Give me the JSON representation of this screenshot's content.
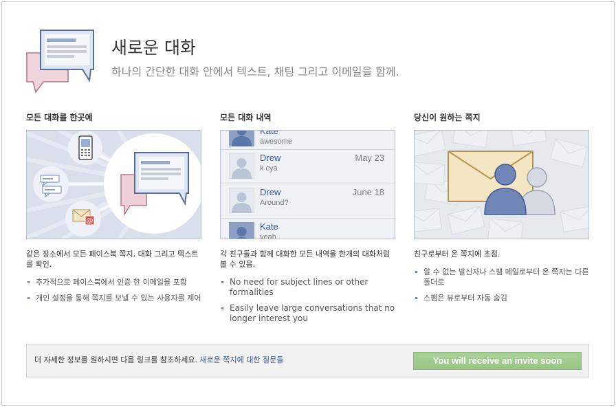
{
  "header": {
    "title": "새로운 대화",
    "subtitle": "하나의 간단한 대화 안에서 텍스트, 채팅 그리고 이메일을 함께."
  },
  "columns": [
    {
      "heading": "모든 대화를 한곳에",
      "description": "같은 장소에서 모든 페이스북 쪽지, 대화 그리고 텍스트를 확인.",
      "bullets": [
        "추가적으로 페이스북에서 인증 한 이메일을 포함",
        "개인 설정을 통해 쪽지를 보낼 수 있는 사용자를 제어"
      ]
    },
    {
      "heading": "모든 대화 내역",
      "description": "각 친구들과 함께 대화한 모든 내역을 한개의 대화처럼 볼 수 있음.",
      "bullets": [
        "No need for subject lines or other formalities",
        "Easily leave large conversations that no longer interest you"
      ]
    },
    {
      "heading": "당신이 원하는 쪽지",
      "description": "친구로부터 온 쪽지에 초점.",
      "bullets": [
        "알 수 없는 발신자나 스팸 메일로부터 온 쪽지는 다른 폴더로",
        "스팸은 뷰로부터 자동 숨김"
      ]
    }
  ],
  "message_list": [
    {
      "name": "Kate",
      "snippet": "awesome"
    },
    {
      "name": "Drew",
      "snippet": "k cya",
      "date": "May 23"
    },
    {
      "name": "Drew",
      "snippet": "Around?",
      "date": "June 18"
    },
    {
      "name": "Kate",
      "snippet": "yeah"
    }
  ],
  "footer": {
    "text": "더 자세한 정보를 원하시면 다음 링크를 참조하세요.",
    "link_label": "새로운 쪽지에 대한 질문들",
    "button_label": "You will receive an invite soon"
  },
  "icons": {
    "header": "speech-bubbles-icon",
    "column_1": [
      "phone-icon",
      "chat-bubbles-icon",
      "email-icon",
      "speech-bubbles-icon"
    ],
    "column_2": [
      "avatar-icon"
    ],
    "column_3": [
      "envelope-icon",
      "person-silhouette-icon"
    ],
    "email_badge_glyph": "@"
  },
  "colors": {
    "link": "#3b5998",
    "bullet": "#6d84b4",
    "button_background": "#9ec98a",
    "button_text": "#ffffff",
    "footer_background": "#f2f2f2"
  }
}
